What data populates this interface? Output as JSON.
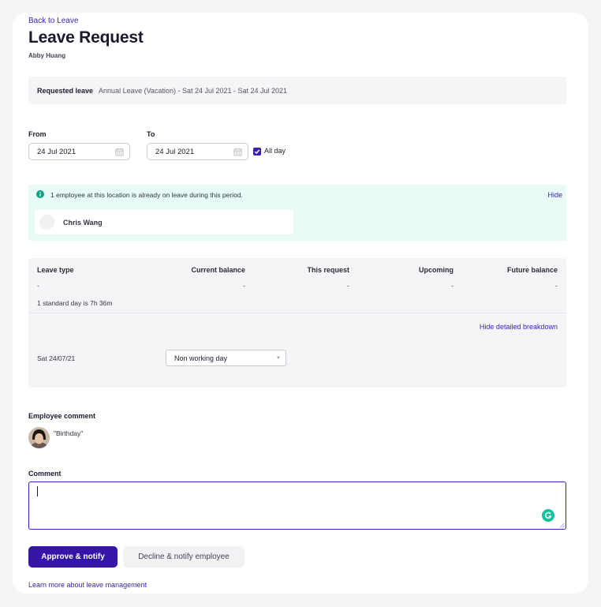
{
  "header": {
    "back_link": "Back to Leave",
    "title": "Leave Request",
    "employee_name": "Abby Huang"
  },
  "requested": {
    "label": "Requested leave",
    "value": "Annual Leave (Vacation) - Sat 24 Jul 2021 - Sat 24 Jul 2021"
  },
  "dates": {
    "from_label": "From",
    "from_value": "24 Jul 2021",
    "to_label": "To",
    "to_value": "24 Jul 2021",
    "all_day_label": "All day",
    "all_day_checked": true
  },
  "alert": {
    "icon": "info-icon",
    "message": "1 employee at this location is already on leave during this period.",
    "hide_label": "Hide",
    "person_name": "Chris Wang"
  },
  "breakdown": {
    "headers": [
      "Leave type",
      "Current balance",
      "This request",
      "Upcoming",
      "Future balance"
    ],
    "values": [
      "-",
      "-",
      "-",
      "-",
      "-"
    ],
    "standard_day_note": "1 standard day is 7h 36m",
    "hide_label": "Hide detailed breakdown",
    "rows": [
      {
        "date": "Sat 24/07/21",
        "selection": "Non working day"
      }
    ]
  },
  "employee_comment": {
    "label": "Employee comment",
    "text": "\"Birthday\""
  },
  "comment": {
    "label": "Comment",
    "value": ""
  },
  "actions": {
    "approve_label": "Approve & notify",
    "decline_label": "Decline & notify employee",
    "learn_more_label": "Learn more about leave management"
  },
  "colors": {
    "accent": "#3515a8",
    "link": "#3d1fb3",
    "alert_bg": "#e9fbf7",
    "panel_bg": "#f5f5f7"
  }
}
